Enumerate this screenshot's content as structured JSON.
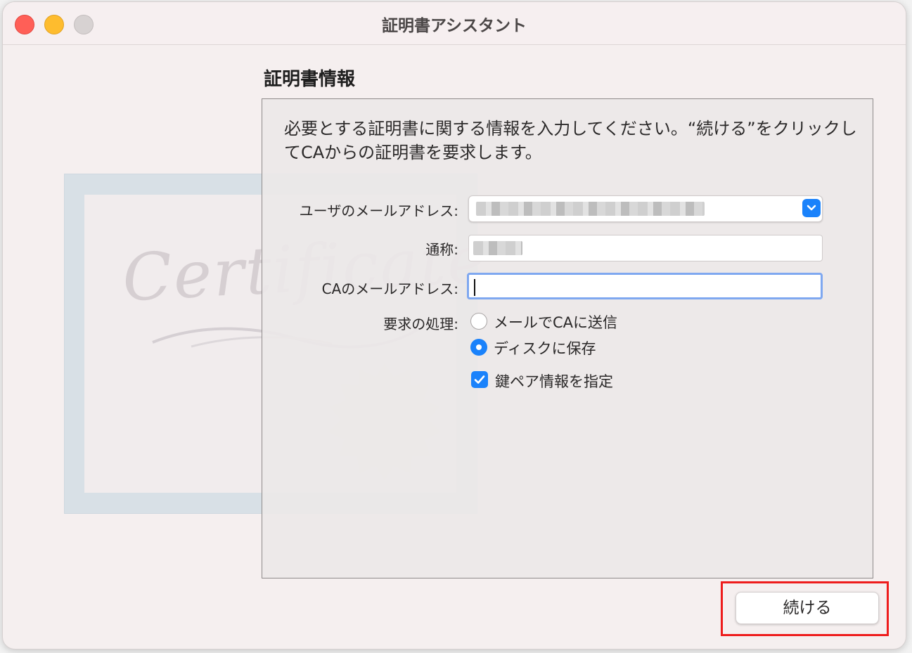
{
  "window": {
    "title": "証明書アシスタント"
  },
  "section": {
    "title": "証明書情報",
    "instructions": "必要とする証明書に関する情報を入力してください。“続ける”をクリックしてCAからの証明書を要求します。"
  },
  "illustration": {
    "script_text": "Certificate"
  },
  "form": {
    "email_label": "ユーザのメールアドレス:",
    "name_label": "通称:",
    "ca_email_label": "CAのメールアドレス:",
    "ca_email_value": "",
    "request_label": "要求の処理:",
    "request_options": [
      {
        "label": "メールでCAに送信",
        "selected": false
      },
      {
        "label": "ディスクに保存",
        "selected": true
      }
    ],
    "keypair_label": "鍵ペア情報を指定",
    "keypair_checked": true
  },
  "buttons": {
    "continue": "続ける"
  },
  "colors": {
    "accent": "#1a82fb",
    "highlight": "#ee1c1c"
  },
  "icons": {
    "dropdown": "chevron-down-icon",
    "checkbox": "checkmark-icon"
  }
}
